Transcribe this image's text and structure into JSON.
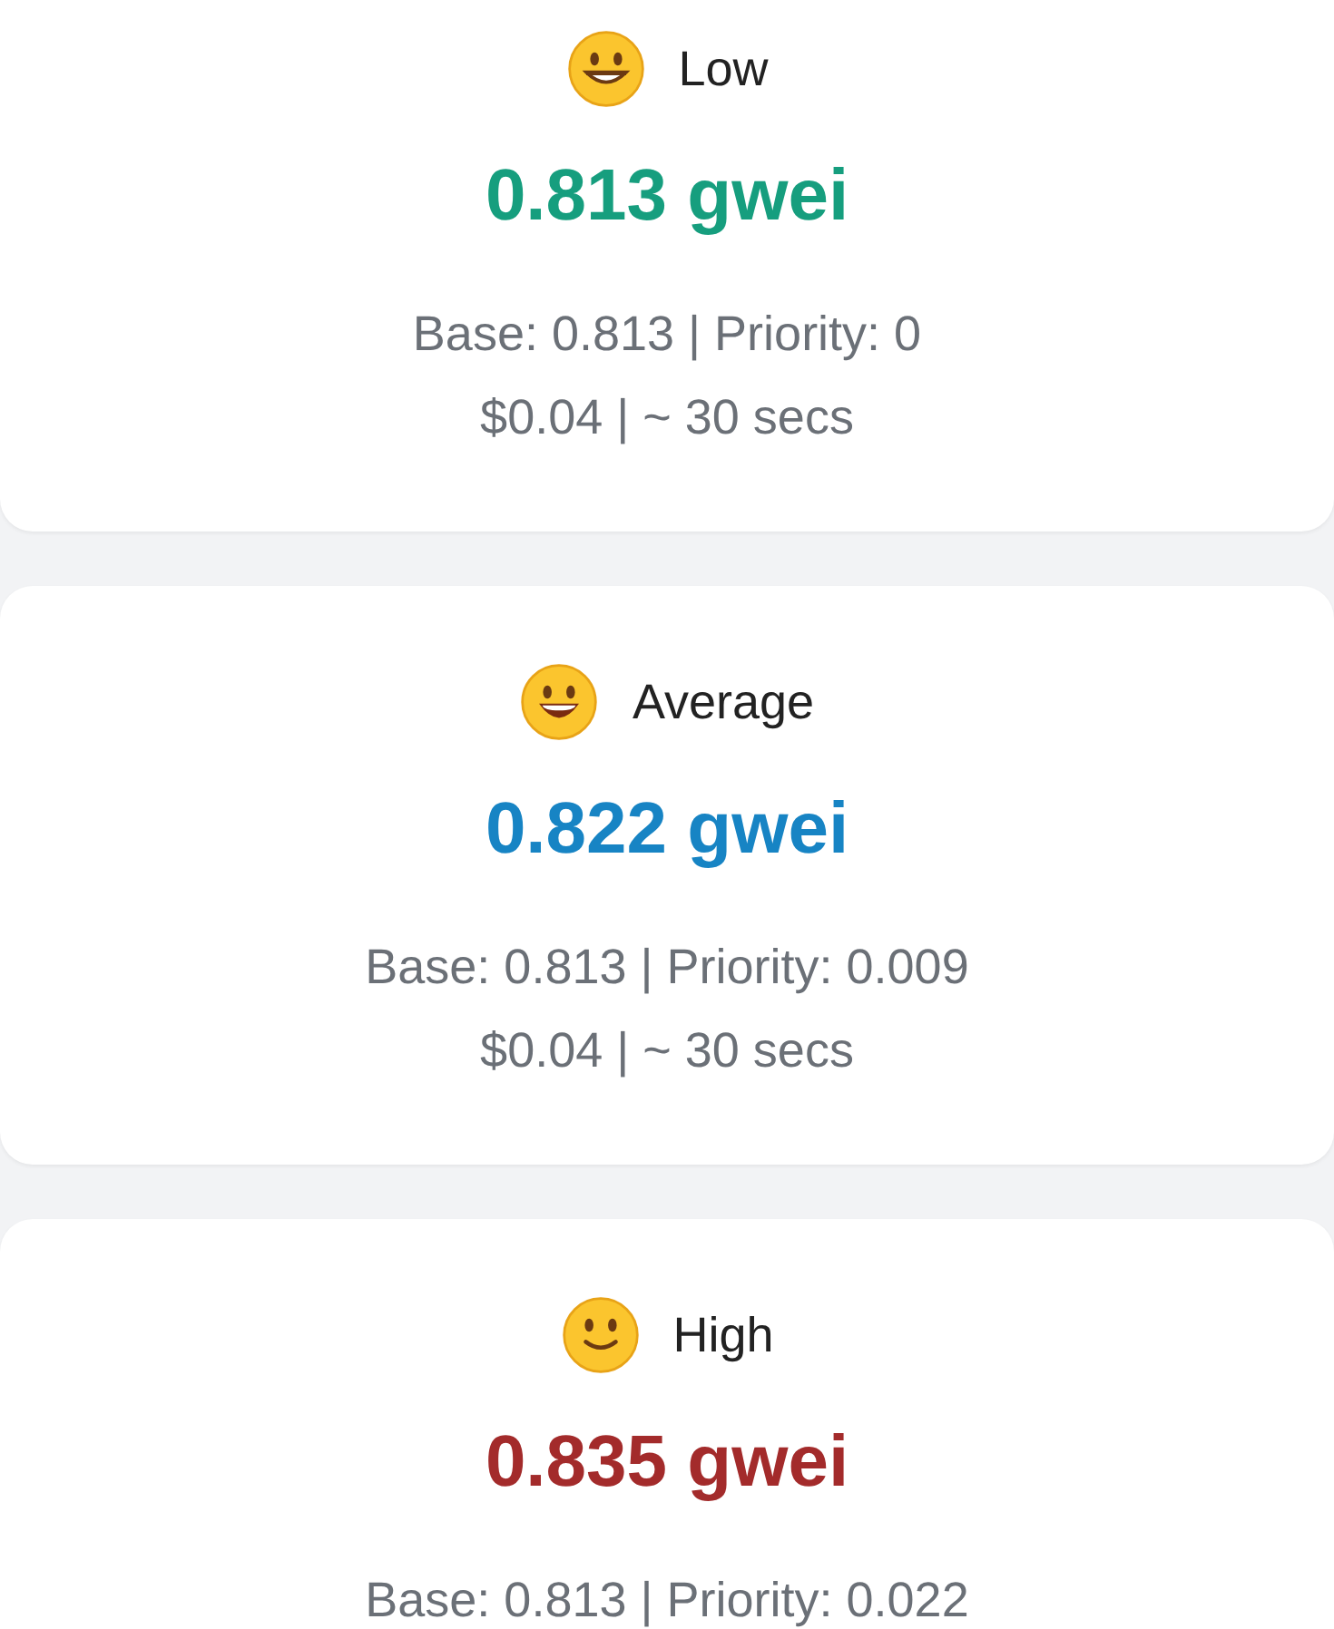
{
  "tiers": [
    {
      "label": "Low",
      "price": "0.813 gwei",
      "color": "#169e7e",
      "details": [
        "Base: 0.813 | Priority: 0",
        "$0.04 | ~ 30 secs"
      ]
    },
    {
      "label": "Average",
      "price": "0.822 gwei",
      "color": "#1784c4",
      "details": [
        "Base: 0.813 | Priority: 0.009",
        "$0.04 | ~ 30 secs"
      ]
    },
    {
      "label": "High",
      "price": "0.835 gwei",
      "color": "#a32b2b",
      "details": [
        "Base: 0.813 | Priority: 0.022"
      ]
    }
  ]
}
